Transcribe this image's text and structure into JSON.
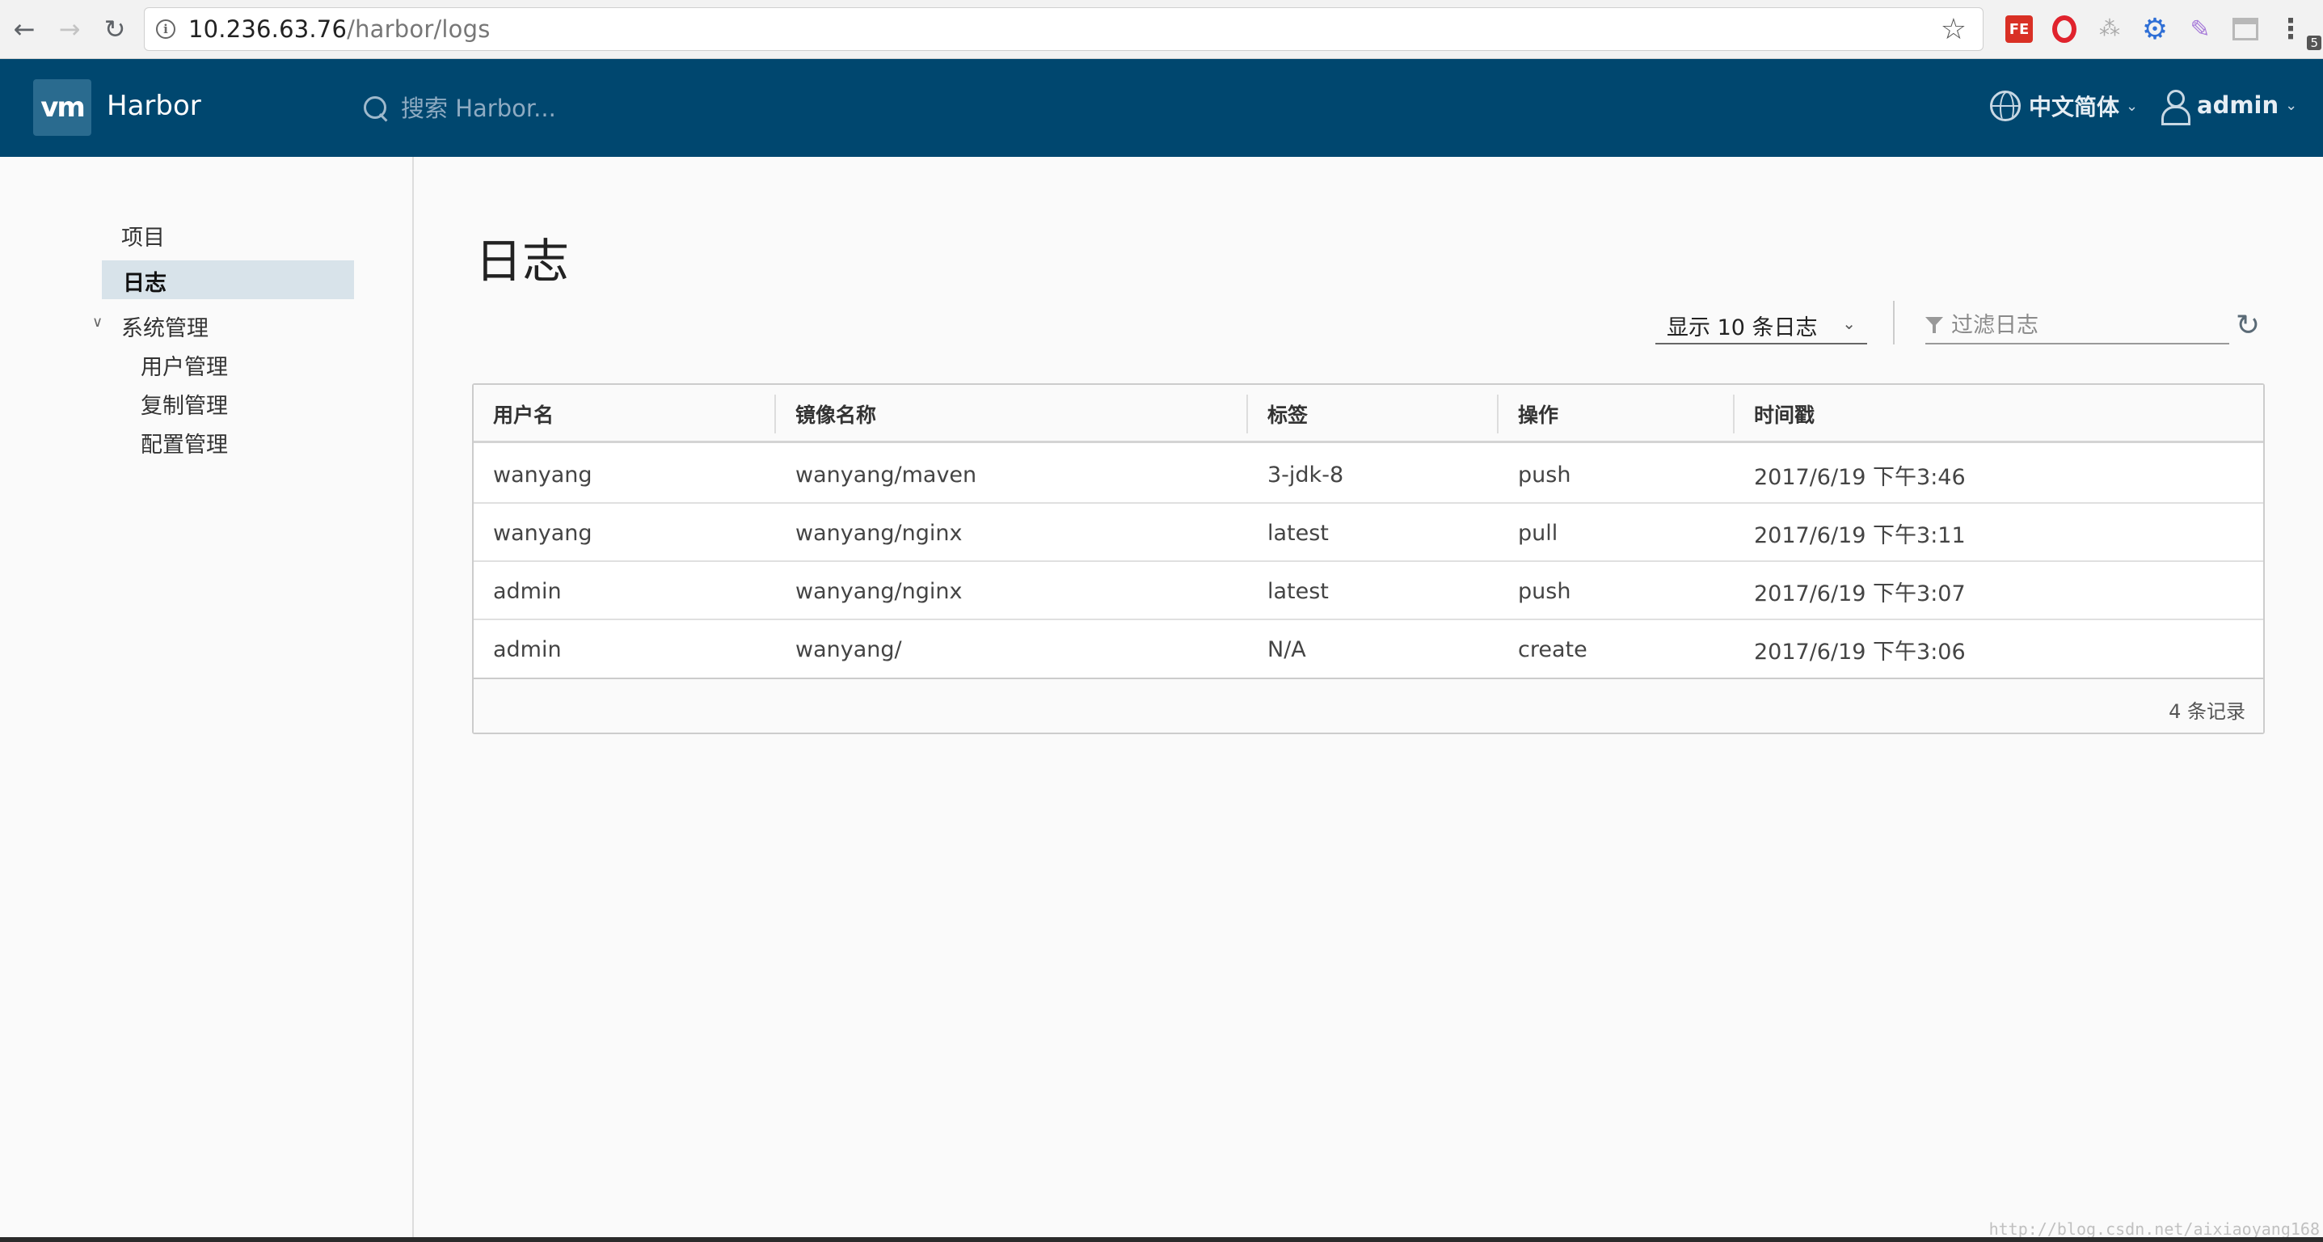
{
  "browser": {
    "back_icon": "arrow-left-icon",
    "forward_icon": "arrow-right-icon",
    "reload_icon": "reload-icon",
    "url_host": "10.236.63.76",
    "url_path": "/harbor/logs",
    "extensions": [
      "fe-extension-icon",
      "opera-extension-icon",
      "tree-extension-icon",
      "gear-extension-icon",
      "pen-extension-icon",
      "panel-extension-icon"
    ],
    "gear_badge": "5"
  },
  "header": {
    "logo_text": "vm",
    "brand": "Harbor",
    "search_placeholder": "搜索 Harbor...",
    "language": "中文简体",
    "user": "admin",
    "bg_color": "#00476f"
  },
  "sidebar": {
    "items": [
      {
        "label": "项目"
      },
      {
        "label": "日志",
        "active": true
      },
      {
        "label": "系统管理",
        "expanded": true
      },
      {
        "label": "用户管理"
      },
      {
        "label": "复制管理"
      },
      {
        "label": "配置管理"
      }
    ]
  },
  "main": {
    "title": "日志",
    "page_size": "显示 10 条日志",
    "filter_placeholder": "过滤日志",
    "table": {
      "columns": [
        "用户名",
        "镜像名称",
        "标签",
        "操作",
        "时间戳"
      ],
      "rows": [
        [
          "wanyang",
          "wanyang/maven",
          "3-jdk-8",
          "push",
          "2017/6/19 下午3:46"
        ],
        [
          "wanyang",
          "wanyang/nginx",
          "latest",
          "pull",
          "2017/6/19 下午3:11"
        ],
        [
          "admin",
          "wanyang/nginx",
          "latest",
          "push",
          "2017/6/19 下午3:07"
        ],
        [
          "admin",
          "wanyang/",
          "N/A",
          "create",
          "2017/6/19 下午3:06"
        ]
      ],
      "footer": "4 条记录"
    }
  },
  "watermark": "http://blog.csdn.net/aixiaoyang168"
}
